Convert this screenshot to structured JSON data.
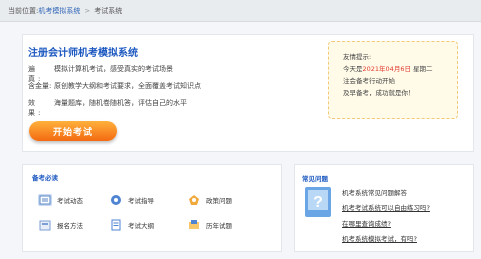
{
  "breadcrumb": {
    "prefix": "当前位置:",
    "link": "机考模拟系统",
    "separator": ">",
    "current": "考试系统"
  },
  "intro": {
    "title": "注册会计师机考模拟系统",
    "rows": [
      {
        "key": "遍 真:",
        "value": "模拟计算机考试，感受真实的考试场景"
      },
      {
        "key": "含金量:",
        "value": "原创教学大纲和考试要求，全面覆盖考试知识点"
      },
      {
        "key": "效 果:",
        "value": "海量题库，随机卷随机答，评估自己的水平"
      }
    ],
    "start_button": "开始考试"
  },
  "tip": {
    "line1": "友情提示:",
    "line2_prefix": "今天是",
    "line2_date": "2021年04月6日",
    "line2_suffix": "星期二",
    "line3": "注会备考行动开始",
    "line4": "及早备考，成功就是你！"
  },
  "notes": {
    "title": "备考必读",
    "items": [
      {
        "label": "考试动态",
        "icon": "news-icon"
      },
      {
        "label": "考试指导",
        "icon": "guide-icon"
      },
      {
        "label": "政策问题",
        "icon": "policy-icon"
      },
      {
        "label": "报名方法",
        "icon": "signup-icon"
      },
      {
        "label": "考试大纲",
        "icon": "syllabus-icon"
      },
      {
        "label": "历年试题",
        "icon": "exam-paper-icon"
      }
    ]
  },
  "faq": {
    "title": "常见问题",
    "items": [
      "机考系统常见问题解答",
      "机考考试系统可以自由练习吗?",
      "在哪里查询成绩?",
      "机考系统模拟考试，有吗?"
    ]
  },
  "colors": {
    "accent_blue": "#1d59c0",
    "start_button_orange": "#f36a10",
    "tip_date_red": "#e3392f"
  }
}
